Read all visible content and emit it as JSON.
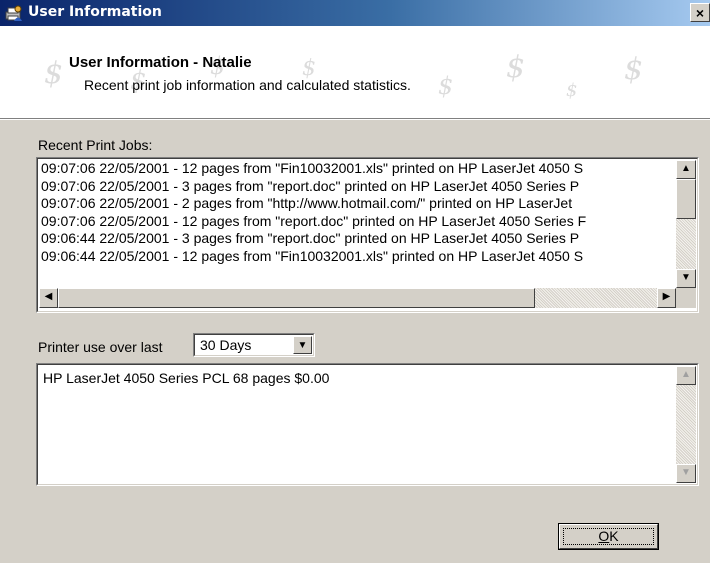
{
  "window": {
    "title": "User Information",
    "close_symbol": "×",
    "icon": "printer-user-icon"
  },
  "banner": {
    "heading": "User Information - Natalie",
    "subtext": "Recent print job information and calculated statistics.",
    "watermark_glyph": "$"
  },
  "recent_jobs": {
    "label": "Recent Print Jobs:",
    "lines": [
      "09:07:06 22/05/2001 -  12 pages from \"Fin10032001.xls\" printed on HP LaserJet 4050 S",
      "09:07:06 22/05/2001 -  3 pages from \"report.doc\" printed on HP LaserJet 4050 Series P",
      "09:07:06 22/05/2001 -  2 pages from \"http://www.hotmail.com/\" printed on HP LaserJet",
      "09:07:06 22/05/2001 -  12 pages from \"report.doc\" printed on HP LaserJet 4050 Series F",
      "09:06:44 22/05/2001 -  3 pages from \"report.doc\" printed on HP LaserJet 4050 Series P",
      "09:06:44 22/05/2001 -  12 pages from \"Fin10032001.xls\" printed on HP LaserJet 4050 S"
    ]
  },
  "printer_use": {
    "label": "Printer use over last",
    "period_selected": "30 Days",
    "stats": "HP LaserJet 4050 Series PCL 68 pages $0.00"
  },
  "buttons": {
    "ok_prefix": "",
    "ok_underlined": "O",
    "ok_rest": "K"
  },
  "colors": {
    "dialog_face": "#d4d0c8",
    "title_start": "#0a246a",
    "title_end": "#a6caf0"
  }
}
